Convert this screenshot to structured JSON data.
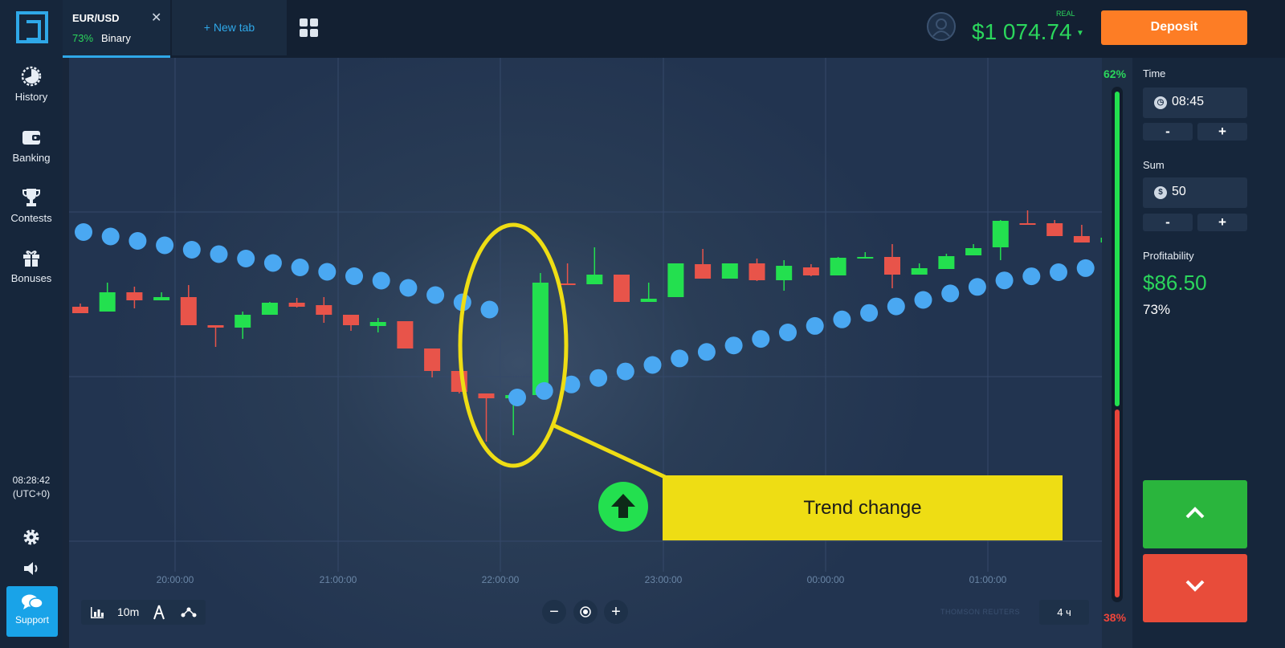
{
  "sidebar": {
    "items": [
      {
        "label": "History",
        "icon": "clock-icon"
      },
      {
        "label": "Banking",
        "icon": "wallet-icon"
      },
      {
        "label": "Contests",
        "icon": "trophy-icon"
      },
      {
        "label": "Bonuses",
        "icon": "gift-icon"
      }
    ],
    "clock_time": "08:28:42",
    "clock_zone": "(UTC+0)",
    "support_label": "Support"
  },
  "header": {
    "tab_pair": "EUR/USD",
    "tab_percent": "73%",
    "tab_type": "Binary",
    "new_tab_label": "+  New tab",
    "account_type": "REAL",
    "balance": "$1 074.74",
    "deposit_label": "Deposit"
  },
  "chart": {
    "x_labels": [
      "20:00:00",
      "21:00:00",
      "22:00:00",
      "23:00:00",
      "00:00:00",
      "01:00:00"
    ],
    "timeframe": "10m",
    "period": "4 ч",
    "watermark": "THOMSON REUTERS",
    "callout_text": "Trend change",
    "colors": {
      "up": "#23e04f",
      "down": "#e8544a",
      "dots": "#4aa8f2",
      "highlight": "#eedd14"
    }
  },
  "sentiment": {
    "up_percent": "62%",
    "down_percent": "38%"
  },
  "panel": {
    "time_label": "Time",
    "time_value": "08:45",
    "sum_label": "Sum",
    "sum_value": "50",
    "minus": "-",
    "plus": "+",
    "profit_label": "Profitability",
    "profit_value": "$86.50",
    "profit_percent": "73%"
  },
  "chart_data": {
    "type": "candlestick",
    "x_labels": [
      "20:00:00",
      "21:00:00",
      "22:00:00",
      "23:00:00",
      "00:00:00",
      "01:00:00"
    ],
    "candles": [
      {
        "o": 310,
        "h": 306,
        "l": 316,
        "c": 318
      },
      {
        "o": 316,
        "h": 280,
        "l": 316,
        "c": 292
      },
      {
        "o": 292,
        "h": 285,
        "l": 312,
        "c": 302
      },
      {
        "o": 302,
        "h": 292,
        "l": 302,
        "c": 298
      },
      {
        "o": 298,
        "h": 283,
        "l": 333,
        "c": 333
      },
      {
        "o": 333,
        "h": 333,
        "l": 360,
        "c": 336
      },
      {
        "o": 336,
        "h": 316,
        "l": 350,
        "c": 320
      },
      {
        "o": 320,
        "h": 304,
        "l": 320,
        "c": 305
      },
      {
        "o": 305,
        "h": 299,
        "l": 311,
        "c": 310
      },
      {
        "o": 308,
        "h": 298,
        "l": 330,
        "c": 320
      },
      {
        "o": 320,
        "h": 325,
        "l": 340,
        "c": 333
      },
      {
        "o": 334,
        "h": 324,
        "l": 342,
        "c": 329
      },
      {
        "o": 328,
        "h": 328,
        "l": 362,
        "c": 362
      },
      {
        "o": 362,
        "h": 362,
        "l": 398,
        "c": 390
      },
      {
        "o": 390,
        "h": 390,
        "l": 418,
        "c": 416
      },
      {
        "o": 418,
        "h": 418,
        "l": 478,
        "c": 424
      },
      {
        "o": 424,
        "h": 424,
        "l": 470,
        "c": 420
      },
      {
        "o": 420,
        "h": 268,
        "l": 424,
        "c": 280
      },
      {
        "o": 281,
        "h": 256,
        "l": 282,
        "c": 282
      },
      {
        "o": 282,
        "h": 236,
        "l": 282,
        "c": 270
      },
      {
        "o": 270,
        "h": 270,
        "l": 304,
        "c": 304
      },
      {
        "o": 304,
        "h": 280,
        "l": 304,
        "c": 300
      },
      {
        "o": 298,
        "h": 256,
        "l": 298,
        "c": 256
      },
      {
        "o": 257,
        "h": 238,
        "l": 275,
        "c": 275
      },
      {
        "o": 275,
        "h": 256,
        "l": 275,
        "c": 256
      },
      {
        "o": 256,
        "h": 250,
        "l": 278,
        "c": 277
      },
      {
        "o": 277,
        "h": 252,
        "l": 290,
        "c": 259
      },
      {
        "o": 261,
        "h": 257,
        "l": 272,
        "c": 271
      },
      {
        "o": 271,
        "h": 248,
        "l": 271,
        "c": 249
      },
      {
        "o": 249,
        "h": 242,
        "l": 250,
        "c": 248
      },
      {
        "o": 248,
        "h": 232,
        "l": 287,
        "c": 270
      },
      {
        "o": 270,
        "h": 256,
        "l": 270,
        "c": 262
      },
      {
        "o": 263,
        "h": 244,
        "l": 262,
        "c": 247
      },
      {
        "o": 246,
        "h": 232,
        "l": 246,
        "c": 237
      },
      {
        "o": 236,
        "h": 202,
        "l": 252,
        "c": 203
      },
      {
        "o": 206,
        "h": 190,
        "l": 208,
        "c": 207
      },
      {
        "o": 206,
        "h": 202,
        "l": 222,
        "c": 222
      },
      {
        "o": 222,
        "h": 208,
        "l": 230,
        "c": 230
      },
      {
        "o": 230,
        "h": 222,
        "l": 230,
        "c": 224
      }
    ],
    "indicator": "parabolic-sar"
  }
}
